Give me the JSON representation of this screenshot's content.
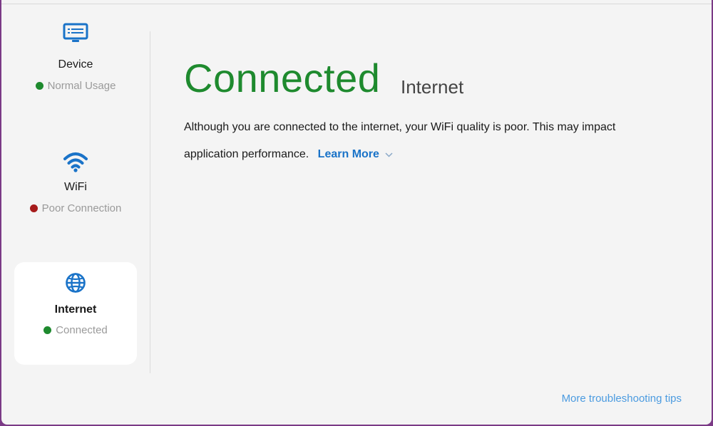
{
  "colors": {
    "accent": "#1a73c8",
    "good": "#1e8a2e",
    "bad": "#a61b1b",
    "link_light": "#4b9be0"
  },
  "sidebar": {
    "items": [
      {
        "label": "Device",
        "status": "Normal Usage",
        "status_color": "#1e8a2e",
        "icon": "monitor-icon",
        "selected": false
      },
      {
        "label": "WiFi",
        "status": "Poor Connection",
        "status_color": "#a61b1b",
        "icon": "wifi-icon",
        "selected": false
      },
      {
        "label": "Internet",
        "status": "Connected",
        "status_color": "#1e8a2e",
        "icon": "globe-icon",
        "selected": true
      }
    ]
  },
  "main": {
    "title": "Connected",
    "subtitle": "Internet",
    "description": "Although you are connected to the internet, your WiFi quality is poor. This may impact application performance.",
    "learn_more_label": "Learn More"
  },
  "footer": {
    "link_label": "More troubleshooting tips"
  }
}
